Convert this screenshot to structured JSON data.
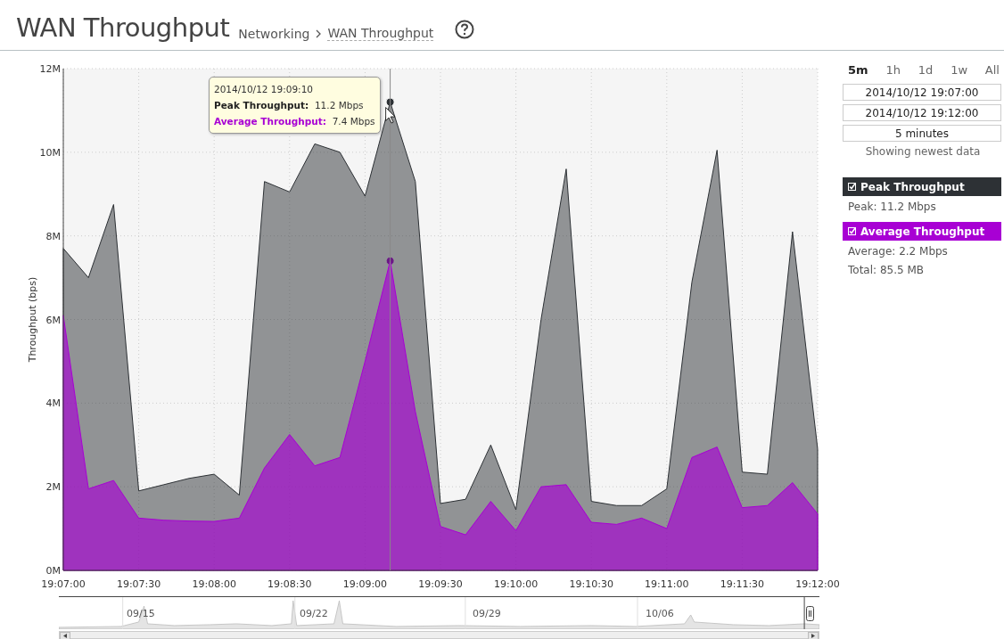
{
  "header": {
    "title": "WAN Throughput",
    "breadcrumb": [
      {
        "label": "Networking",
        "current": false
      },
      {
        "label": "WAN Throughput",
        "current": true
      }
    ]
  },
  "chart": {
    "chart_data": {
      "type": "area",
      "ylabel": "Throughput (bps)",
      "categories": [
        "19:07:00",
        null,
        null,
        "19:07:30",
        null,
        null,
        "19:08:00",
        null,
        null,
        "19:08:30",
        null,
        null,
        "19:09:00",
        null,
        null,
        "19:09:30",
        null,
        null,
        "19:10:00",
        null,
        null,
        "19:10:30",
        null,
        null,
        "19:11:00",
        null,
        null,
        "19:11:30",
        null,
        null,
        "19:12:00"
      ],
      "grid": true,
      "series": [
        {
          "name": "Peak Throughput",
          "color": "#2d3135",
          "values": [
            7.7,
            7.0,
            8.75,
            1.9,
            2.05,
            2.2,
            2.3,
            1.8,
            9.3,
            9.05,
            10.2,
            10.0,
            8.95,
            11.2,
            9.3,
            1.6,
            1.7,
            3.0,
            1.45,
            6.0,
            9.6,
            1.65,
            1.55,
            1.55,
            1.95,
            6.9,
            10.05,
            2.35,
            2.3,
            8.1,
            2.9
          ]
        },
        {
          "name": "Average Throughput",
          "color": "#a800d4",
          "values": [
            6.1,
            1.95,
            2.15,
            1.25,
            1.2,
            1.18,
            1.17,
            1.25,
            2.45,
            3.25,
            2.5,
            2.7,
            5.0,
            7.4,
            3.8,
            1.05,
            0.85,
            1.65,
            0.95,
            2.0,
            2.05,
            1.15,
            1.1,
            1.25,
            1.0,
            2.7,
            2.95,
            1.5,
            1.55,
            2.1,
            1.35
          ]
        }
      ],
      "ylim": [
        0,
        12
      ],
      "yticks": [
        {
          "value": 0,
          "label": "0M"
        },
        {
          "value": 2,
          "label": "2M"
        },
        {
          "value": 4,
          "label": "4M"
        },
        {
          "value": 6,
          "label": "6M"
        },
        {
          "value": 8,
          "label": "8M"
        },
        {
          "value": 10,
          "label": "10M"
        },
        {
          "value": 12,
          "label": "12M"
        }
      ]
    },
    "tooltip": {
      "time": "2014/10/12 19:09:10",
      "rows": [
        {
          "label": "Peak Throughput:",
          "value": "11.2 Mbps",
          "color": "#222222"
        },
        {
          "label": "Average Throughput:",
          "value": "7.4 Mbps",
          "color": "#a800d4"
        }
      ]
    }
  },
  "navigator": {
    "labels": [
      "09/15",
      "09/22",
      "09/29",
      "10/06"
    ]
  },
  "sidebar": {
    "ranges": [
      {
        "label": "5m",
        "selected": true
      },
      {
        "label": "1h",
        "selected": false
      },
      {
        "label": "1d",
        "selected": false
      },
      {
        "label": "1w",
        "selected": false
      },
      {
        "label": "All",
        "selected": false
      }
    ],
    "start": "2014/10/12 19:07:00",
    "end": "2014/10/12 19:12:00",
    "duration": "5 minutes",
    "status": "Showing newest data",
    "legend": [
      {
        "checked": true,
        "stats": [
          "Peak: 11.2 Mbps"
        ]
      },
      {
        "checked": true,
        "stats": [
          "Average: 2.2 Mbps",
          "Total: 85.5 MB"
        ]
      }
    ]
  }
}
